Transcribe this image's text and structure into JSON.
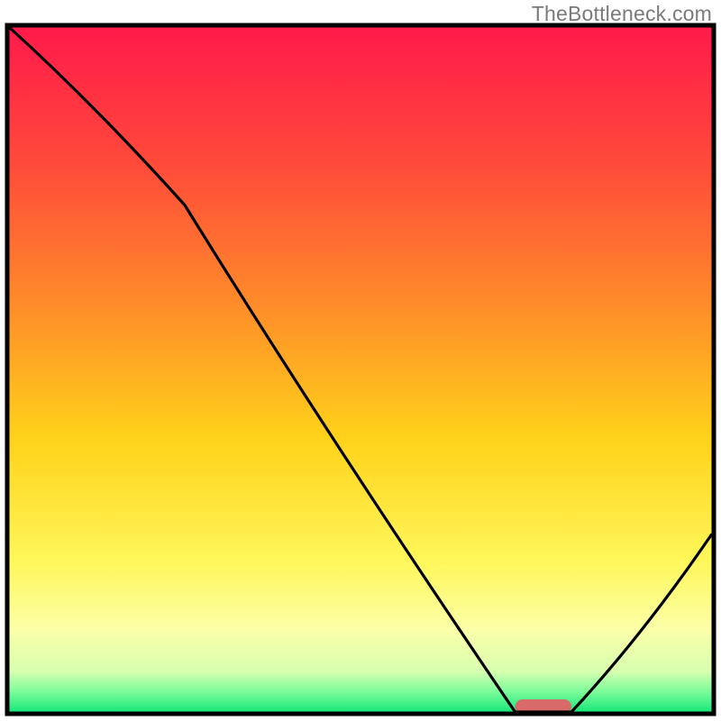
{
  "watermark": "TheBottleneck.com",
  "chart_data": {
    "type": "line",
    "title": "",
    "xlabel": "",
    "ylabel": "",
    "xlim": [
      0,
      100
    ],
    "ylim": [
      0,
      100
    ],
    "x": [
      0,
      25,
      72,
      80,
      100
    ],
    "values": [
      100,
      74,
      0,
      0,
      26
    ],
    "optimal_range_x": [
      72,
      80
    ],
    "gradient_stops": [
      {
        "offset": 0,
        "color": "#ff1a4b"
      },
      {
        "offset": 20,
        "color": "#ff4a3a"
      },
      {
        "offset": 40,
        "color": "#ff8a2a"
      },
      {
        "offset": 60,
        "color": "#ffd21a"
      },
      {
        "offset": 78,
        "color": "#fff75a"
      },
      {
        "offset": 88,
        "color": "#fbffa8"
      },
      {
        "offset": 94,
        "color": "#d8ffb0"
      },
      {
        "offset": 97,
        "color": "#7dfc9a"
      },
      {
        "offset": 100,
        "color": "#17e87a"
      }
    ],
    "marker_color": "#d96a6a",
    "frame_color": "#000000",
    "line_color": "#000000"
  }
}
